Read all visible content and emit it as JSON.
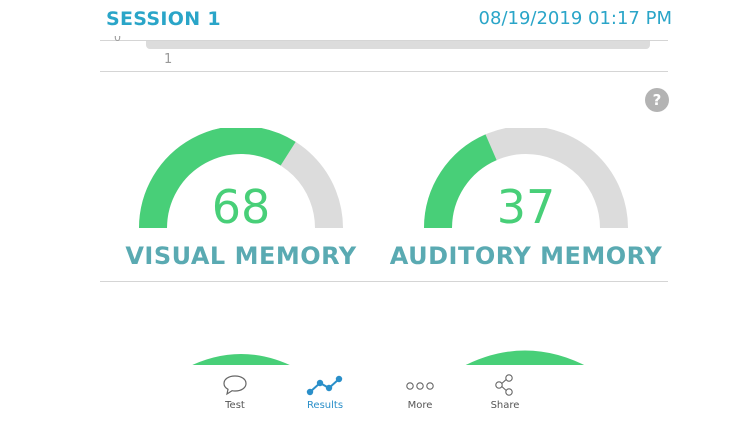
{
  "header": {
    "session_title": "SESSION 1",
    "session_datetime": "08/19/2019 01:17 PM"
  },
  "mini_chart": {
    "tick_label": "1",
    "partial_zero": "0"
  },
  "help": {
    "icon": "question-circle-icon",
    "glyph": "?"
  },
  "gauges": [
    {
      "value": 68,
      "label": "VISUAL MEMORY",
      "max": 100
    },
    {
      "value": 37,
      "label": "AUDITORY MEMORY",
      "max": 100
    }
  ],
  "colors": {
    "accent_blue": "#2aa5c8",
    "gauge_fill": "#48cf78",
    "gauge_track": "#dcdcdc",
    "gauge_label": "#5aaab2",
    "tab_active": "#2a8fc9"
  },
  "tabbar": {
    "items": [
      {
        "label": "Test",
        "icon": "speech-bubble-icon",
        "active": false
      },
      {
        "label": "Results",
        "icon": "line-chart-icon",
        "active": true
      },
      {
        "label": "More",
        "icon": "more-dots-icon",
        "active": false
      },
      {
        "label": "Share",
        "icon": "share-icon",
        "active": false
      }
    ]
  }
}
